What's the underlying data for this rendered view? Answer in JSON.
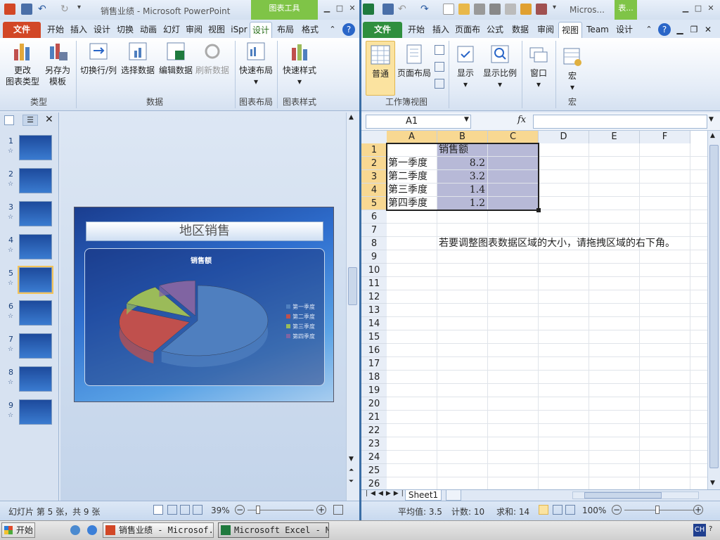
{
  "ppt": {
    "title": "销售业绩 - Microsoft PowerPoint",
    "context_tab": "图表工具",
    "tabs": [
      "文件",
      "开始",
      "插入",
      "设计",
      "切换",
      "动画",
      "幻灯",
      "审阅",
      "视图",
      "iSpr",
      "设计",
      "布局",
      "格式"
    ],
    "ribbon": {
      "buttons": [
        {
          "label1": "更改",
          "label2": "图表类型",
          "icon": "chart-type-icon"
        },
        {
          "label1": "另存为",
          "label2": "模板",
          "icon": "save-template-icon"
        },
        {
          "label1": "切换行/列",
          "label2": "",
          "icon": "switch-row-col-icon"
        },
        {
          "label1": "选择数据",
          "label2": "",
          "icon": "select-data-icon"
        },
        {
          "label1": "编辑数据",
          "label2": "",
          "icon": "edit-data-icon"
        },
        {
          "label1": "刷新数据",
          "label2": "",
          "icon": "refresh-data-icon"
        },
        {
          "label1": "快速布局",
          "label2": "▾",
          "icon": "quick-layout-icon"
        },
        {
          "label1": "快速样式",
          "label2": "▾",
          "icon": "quick-style-icon"
        }
      ],
      "groups": [
        "类型",
        "数据",
        "图表布局",
        "图表样式"
      ]
    },
    "slide_numbers": [
      "1",
      "2",
      "3",
      "4",
      "5",
      "6",
      "7",
      "8",
      "9"
    ],
    "slide": {
      "title": "地区销售",
      "chart_title": "销售额",
      "legend": [
        "第一季度",
        "第二季度",
        "第三季度",
        "第四季度"
      ]
    },
    "status": {
      "left": "幻灯片 第 5 张，共 9 张",
      "zoom": "39%"
    }
  },
  "excel": {
    "title": "Micros...",
    "context_tab": "表...",
    "tabs": [
      "文件",
      "开始",
      "插入",
      "页面布",
      "公式",
      "数据",
      "审阅",
      "视图",
      "Team",
      "设计"
    ],
    "ribbon": {
      "buttons": [
        "普通",
        "页面布局",
        "显示",
        "显示比例",
        "窗口",
        "宏"
      ],
      "groups": [
        "工作簿视图",
        "宏"
      ]
    },
    "namebox": "A1",
    "fx": "fx",
    "columns": [
      "A",
      "B",
      "C",
      "D",
      "E",
      "F"
    ],
    "rows": [
      "1",
      "2",
      "3",
      "4",
      "5",
      "6",
      "7",
      "8",
      "9",
      "10",
      "11",
      "12",
      "13",
      "14",
      "15",
      "16",
      "17",
      "18",
      "19",
      "20",
      "21",
      "22",
      "23",
      "24",
      "25",
      "26"
    ],
    "header_b": "销售额",
    "data": [
      {
        "label": "第一季度",
        "value": "8.2"
      },
      {
        "label": "第二季度",
        "value": "3.2"
      },
      {
        "label": "第三季度",
        "value": "1.4"
      },
      {
        "label": "第四季度",
        "value": "1.2"
      }
    ],
    "note": "若要调整图表数据区域的大小，请拖拽区域的右下角。",
    "sheet_tab": "Sheet1",
    "status": {
      "avg": "平均值: 3.5",
      "count": "计数: 10",
      "sum": "求和: 14",
      "zoom": "100%"
    }
  },
  "chart_data": {
    "type": "pie",
    "title": "销售额",
    "categories": [
      "第一季度",
      "第二季度",
      "第三季度",
      "第四季度"
    ],
    "values": [
      8.2,
      3.2,
      1.4,
      1.2
    ],
    "colors": [
      "#4f7fbf",
      "#c0504d",
      "#9bbb59",
      "#8064a2"
    ],
    "legend": "right"
  },
  "taskbar": {
    "start": "开始",
    "items": [
      "销售业绩 - Microsof...",
      "Microsoft Excel - M..."
    ],
    "ime": "CH"
  }
}
